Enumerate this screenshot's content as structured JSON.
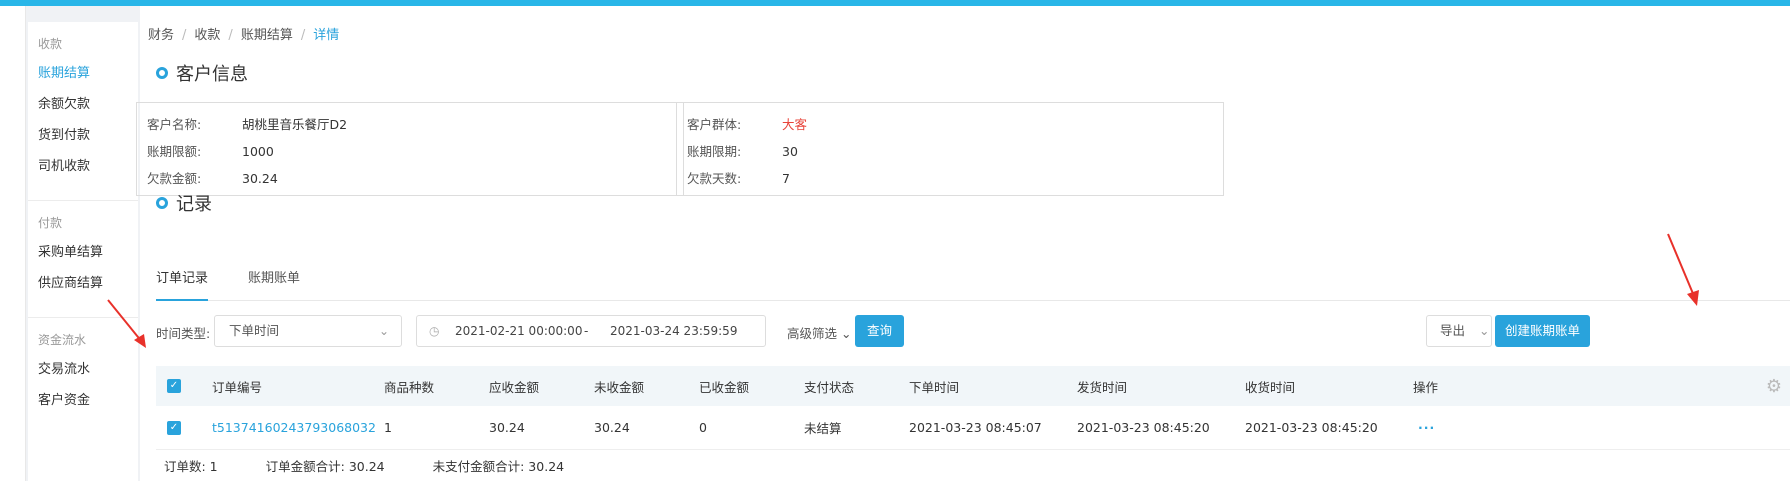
{
  "sidebar": {
    "groups": [
      {
        "title": "收款",
        "items": [
          "账期结算",
          "余额欠款",
          "货到付款",
          "司机收款"
        ]
      },
      {
        "title": "付款",
        "items": [
          "采购单结算",
          "供应商结算"
        ]
      },
      {
        "title": "资金流水",
        "items": [
          "交易流水",
          "客户资金"
        ]
      }
    ]
  },
  "breadcrumb": [
    "财务",
    "收款",
    "账期结算",
    "详情"
  ],
  "customer": {
    "title": "客户信息",
    "left": [
      {
        "k": "客户名称:",
        "v": "胡桃里音乐餐厅D2"
      },
      {
        "k": "账期限额:",
        "v": "1000"
      },
      {
        "k": "欠款金额:",
        "v": "30.24"
      }
    ],
    "right": [
      {
        "k": "客户群体:",
        "v": "大客"
      },
      {
        "k": "账期限期:",
        "v": "30"
      },
      {
        "k": "欠款天数:",
        "v": "7"
      }
    ]
  },
  "records": {
    "title": "记录",
    "tabs": [
      "订单记录",
      "账期账单"
    ]
  },
  "filters": {
    "time_type_label": "时间类型:",
    "time_type_value": "下单时间",
    "date_from": "2021-02-21 00:00:00",
    "date_sep": "-",
    "date_to": "2021-03-24 23:59:59",
    "advanced": "高级筛选",
    "query": "查询",
    "export": "导出",
    "create": "创建账期账单"
  },
  "table": {
    "headers": [
      "订单编号",
      "商品种数",
      "应收金额",
      "未收金额",
      "已收金额",
      "支付状态",
      "下单时间",
      "发货时间",
      "收货时间",
      "操作"
    ],
    "rows": [
      [
        "t51374160243793068032",
        "1",
        "30.24",
        "30.24",
        "0",
        "未结算",
        "2021-03-23 08:45:07",
        "2021-03-23 08:45:20",
        "2021-03-23 08:45:20",
        "···"
      ]
    ]
  },
  "summary": {
    "count": "订单数:  1",
    "total": "订单金额合计:  30.24",
    "unpaid": "未支付金额合计:  30.24"
  },
  "colors": {
    "accent": "#29a3dc",
    "top_bar": "#29b6e8",
    "highlight": "#e8443a",
    "arrow": "#e8312a"
  }
}
